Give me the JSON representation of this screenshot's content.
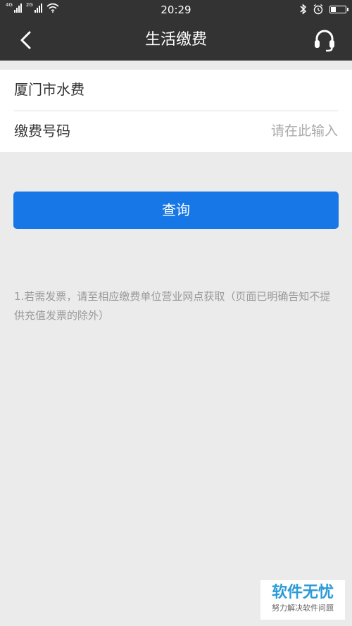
{
  "status_bar": {
    "network_1": "4G",
    "network_2": "2G",
    "time": "20:29",
    "icons": [
      "signal-icon",
      "signal-icon",
      "wifi-icon",
      "bluetooth-icon",
      "alarm-icon",
      "battery-icon"
    ],
    "battery_level": 0.35
  },
  "nav": {
    "title": "生活缴费",
    "back_icon": "chevron-left-icon",
    "service_icon": "headset-icon"
  },
  "form": {
    "biller": "厦门市水费",
    "account_label": "缴费号码",
    "account_placeholder": "请在此输入",
    "account_value": ""
  },
  "query_button": "查询",
  "note": "1.若需发票，请至相应缴费单位营业网点获取（页面已明确告知不提供充值发票的除外）",
  "watermark": {
    "title": "软件无忧",
    "subtitle": "努力解决软件问题"
  },
  "colors": {
    "header": "#333333",
    "background": "#ebebeb",
    "primary": "#1877e6",
    "watermark": "#2b9bd7"
  }
}
